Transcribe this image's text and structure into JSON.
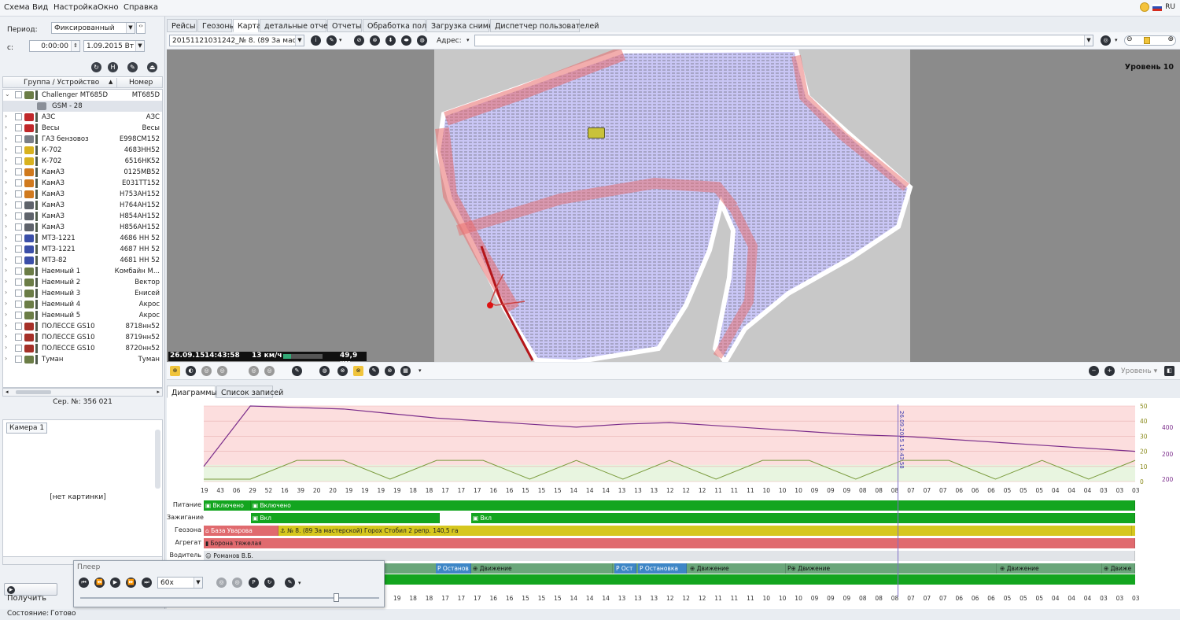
{
  "menu": [
    "Схема",
    "Вид",
    "Настройка",
    "Окно",
    "Справка"
  ],
  "lang": "RU",
  "period": {
    "label": "Период:",
    "value": "Фиксированный",
    "from_label": "с:",
    "time": "0:00:00",
    "date": "1.09.2015 Вт"
  },
  "tree": {
    "col_group": "Группа / Устройство",
    "col_number": "Номер",
    "rows": [
      {
        "name": "Challenger MT685D",
        "number": "MT685D",
        "expanded": true,
        "icon_color": "#6b7d46"
      },
      {
        "name": "GSM - 28",
        "number": "",
        "sub": true,
        "icon_color": "#8a8f98"
      },
      {
        "name": "АЗС",
        "number": "АЗС",
        "icon_color": "#c0282a"
      },
      {
        "name": "Весы",
        "number": "Весы",
        "icon_color": "#c0282a"
      },
      {
        "name": "ГАЗ бензовоз",
        "number": "E998CM152",
        "icon_color": "#7a7f87"
      },
      {
        "name": "К-702",
        "number": "4683HH52",
        "icon_color": "#d8b21f"
      },
      {
        "name": "К-702",
        "number": "6516HK52",
        "icon_color": "#d8b21f"
      },
      {
        "name": "КамАЗ",
        "number": "0125MB52",
        "icon_color": "#d07a1e"
      },
      {
        "name": "КамАЗ",
        "number": "E031TT152",
        "icon_color": "#d07a1e"
      },
      {
        "name": "КамАЗ",
        "number": "H753AH152",
        "icon_color": "#d07a1e"
      },
      {
        "name": "КамАЗ",
        "number": "H764AH152",
        "icon_color": "#5e636b"
      },
      {
        "name": "КамАЗ",
        "number": "H854AH152",
        "icon_color": "#5e636b"
      },
      {
        "name": "КамАЗ",
        "number": "H856AH152",
        "icon_color": "#5e636b"
      },
      {
        "name": "МТЗ-1221",
        "number": "4686 HH 52",
        "icon_color": "#3b4fa8"
      },
      {
        "name": "МТЗ-1221",
        "number": "4687 HH 52",
        "icon_color": "#3b4fa8"
      },
      {
        "name": "МТЗ-82",
        "number": "4681 HH 52",
        "icon_color": "#3b4fa8"
      },
      {
        "name": "Наемный 1",
        "number": "Комбайн М...",
        "icon_color": "#6b7d46"
      },
      {
        "name": "Наемный 2",
        "number": "Вектор",
        "icon_color": "#6b7d46"
      },
      {
        "name": "Наемный 3",
        "number": "Енисей",
        "icon_color": "#6b7d46"
      },
      {
        "name": "Наемный 4",
        "number": "Акрос",
        "icon_color": "#6b7d46"
      },
      {
        "name": "Наемный 5",
        "number": "Акрос",
        "icon_color": "#6b7d46"
      },
      {
        "name": "ПОЛЕССЕ GS10",
        "number": "8718нн52",
        "icon_color": "#a53028"
      },
      {
        "name": "ПОЛЕССЕ GS10",
        "number": "8719нн52",
        "icon_color": "#a53028"
      },
      {
        "name": "ПОЛЕССЕ GS10",
        "number": "8720нн52",
        "icon_color": "#a53028"
      },
      {
        "name": "Туман",
        "number": "Туман",
        "icon_color": "#6b7d46"
      }
    ]
  },
  "serial": "Сер. №: 356 021",
  "camera": {
    "tab": "Камера 1",
    "no_image": "[нет картинки]"
  },
  "get_button": "Получить",
  "status": {
    "label": "Состояние:",
    "value": "Готово"
  },
  "tabs": [
    "Рейсы",
    "Геозоны",
    "Карта",
    "детальные отчеты",
    "Отчеты",
    "Обработка полей",
    "Загрузка снимков",
    "Диспетчер пользователей"
  ],
  "active_tab": 2,
  "map": {
    "track_select": "20151121031242_№ 8. (89 За масте...",
    "address_label": "Адрес:",
    "level": "Уровень 10",
    "info_date": "26.09.15",
    "info_time": "14:43:58",
    "info_speed": "13 км/ч",
    "info_dist": "49,9 км"
  },
  "map_level2": "Уровень",
  "bottom_tabs": [
    "Диаграммы",
    "Список записей"
  ],
  "chart_data": {
    "type": "line",
    "series": [
      {
        "name": "",
        "color": "#7b2d8b",
        "values": [
          10,
          50,
          49,
          48,
          45,
          42,
          40,
          38,
          36,
          38,
          39,
          37,
          35,
          33,
          31,
          30,
          28,
          26,
          24,
          22,
          20
        ]
      },
      {
        "name": "",
        "color": "#7a9b3c",
        "values": [
          0,
          0,
          14,
          14,
          0,
          14,
          14,
          0,
          14,
          0,
          14,
          0,
          14,
          14,
          0,
          14,
          14,
          0,
          14,
          0,
          14
        ]
      }
    ],
    "yticks_left": [
      "50",
      "40",
      "30",
      "20",
      "10",
      "0"
    ],
    "yticks_right": [
      "400",
      "200",
      "200"
    ],
    "cursor_label": "26.09.2015 14:43:58",
    "x_ticks": [
      "19",
      "43",
      "06",
      "29",
      "52",
      "16",
      "39",
      "20",
      "20",
      "19",
      "19",
      "19",
      "19",
      "18",
      "18",
      "17",
      "17",
      "17",
      "16",
      "16",
      "15",
      "15",
      "15",
      "14",
      "14",
      "14",
      "13",
      "13",
      "13",
      "12",
      "12",
      "12",
      "11",
      "11",
      "11",
      "10",
      "10",
      "10",
      "09",
      "09",
      "09",
      "08",
      "08",
      "08",
      "07",
      "07",
      "07",
      "06",
      "06",
      "06",
      "05",
      "05",
      "05",
      "04",
      "04",
      "04",
      "03",
      "03",
      "03"
    ]
  },
  "rows": {
    "power": {
      "label": "Питание",
      "segs": [
        "Включено",
        "Включено"
      ]
    },
    "ignition": {
      "label": "Зажигание",
      "segs": [
        "Вкл",
        "Вкл"
      ]
    },
    "geozone": {
      "label": "Геозона",
      "segs": [
        "База Уварова",
        "№ 8. (89 За мастерской) Горох Стобил 2 репр. 140,5 га"
      ]
    },
    "aggregate": {
      "label": "Агрегат",
      "segs": [
        "Борона тяжелая"
      ]
    },
    "driver": {
      "label": "Водитель",
      "segs": [
        "Романов В.Б."
      ]
    },
    "movement": {
      "segs": [
        "Останов",
        "Движение",
        "Ост",
        "Остановка",
        "Движение",
        "Движение",
        "Движение",
        "Движе"
      ]
    }
  },
  "player": {
    "title": "Плеер",
    "speed": "60x"
  }
}
